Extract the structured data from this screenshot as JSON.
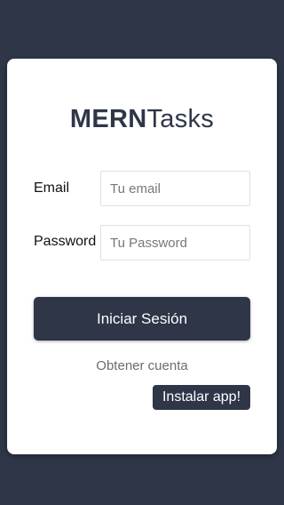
{
  "brand": {
    "strong": "MERN",
    "light": "Tasks"
  },
  "form": {
    "email_label": "Email",
    "email_placeholder": "Tu email",
    "email_value": "",
    "password_label": "Password",
    "password_placeholder": "Tu Password",
    "password_value": "",
    "submit_label": "Iniciar Sesión"
  },
  "links": {
    "signup": "Obtener cuenta"
  },
  "install": {
    "label": "Instalar app!"
  },
  "colors": {
    "background": "#2e3648",
    "card": "#ffffff",
    "primary": "#2e3648"
  }
}
